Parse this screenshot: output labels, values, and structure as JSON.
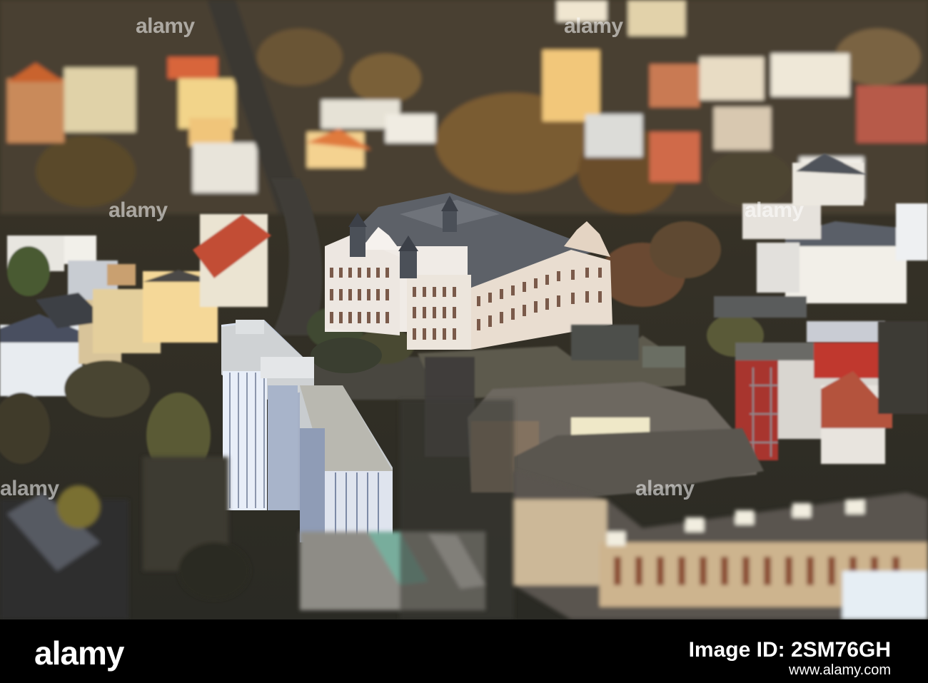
{
  "photo": {
    "subject": "Aerial tilt-shift view of a historic town hall and city blocks",
    "watermark_text": "alamy"
  },
  "footer": {
    "brand": "alamy",
    "image_id": "Image ID: 2SM76GH",
    "url": "www.alamy.com"
  }
}
